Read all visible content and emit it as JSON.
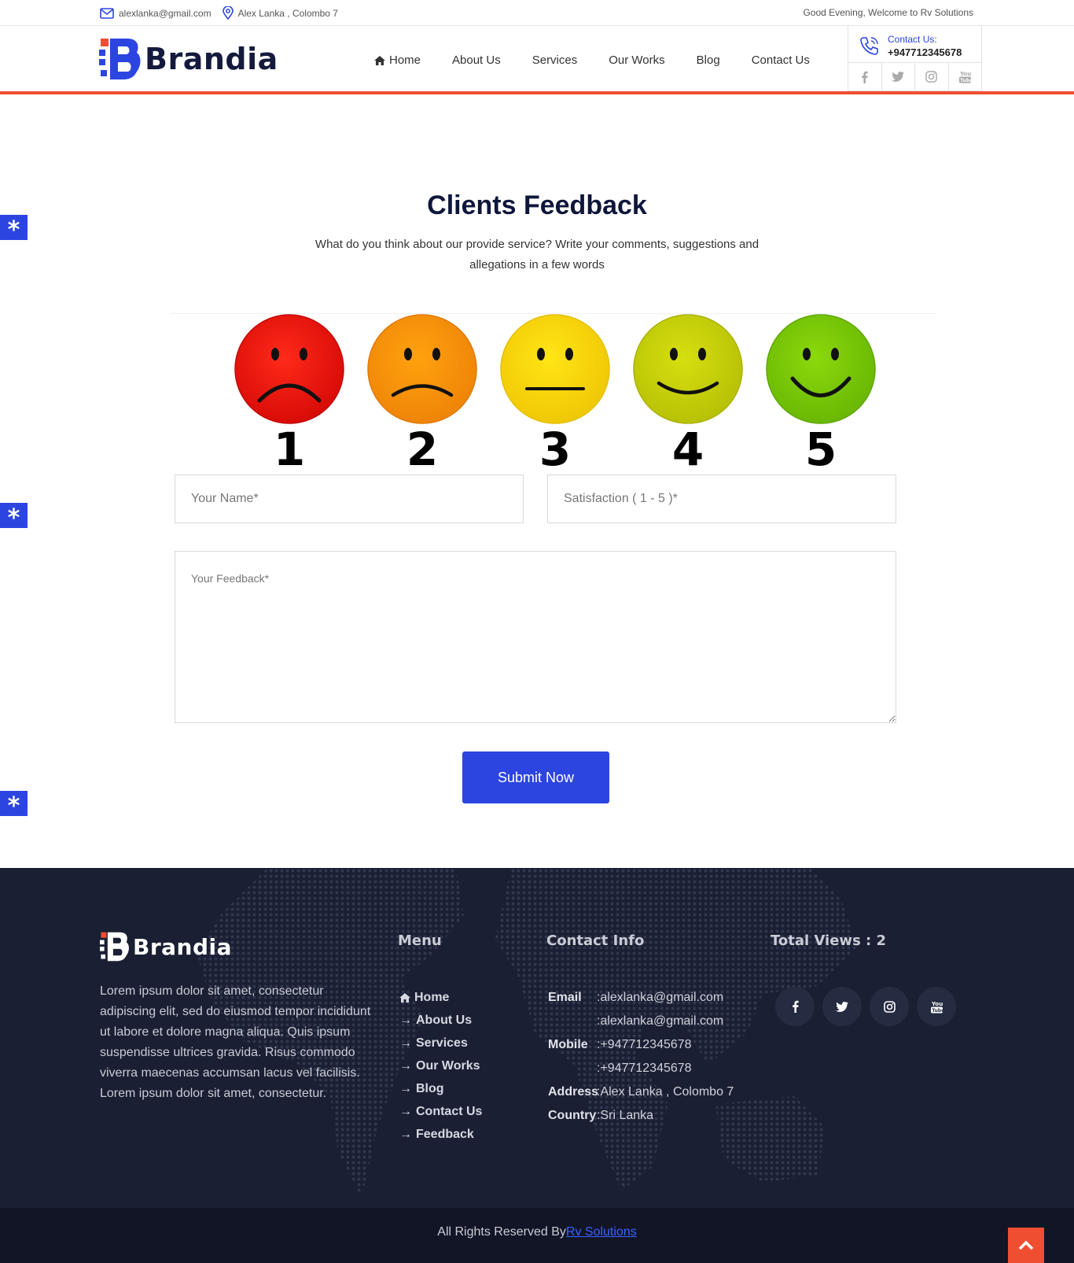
{
  "topbar": {
    "email": "alexlanka@gmail.com",
    "location": "Alex Lanka , Colombo 7",
    "greeting": "Good Evening, Welcome to Rv Solutions"
  },
  "brand": {
    "name": "Brandia"
  },
  "nav": {
    "home": "Home",
    "about": "About Us",
    "services": "Services",
    "works": "Our Works",
    "blog": "Blog",
    "contact": "Contact Us"
  },
  "header_contact": {
    "label": "Contact Us:",
    "phone": "+947712345678"
  },
  "feedback": {
    "title": "Clients Feedback",
    "subtitle": "What do you think about our provide service? Write your comments, suggestions and allegations in a few words",
    "ratings": [
      "1",
      "2",
      "3",
      "4",
      "5"
    ],
    "name_placeholder": "Your Name*",
    "satisfaction_placeholder": "Satisfaction ( 1 - 5 )*",
    "feedback_placeholder": "Your Feedback*",
    "submit_label": "Submit Now"
  },
  "footer": {
    "about": "Lorem ipsum dolor sit amet, consectetur adipiscing elit, sed do eiusmod tempor incididunt ut labore et dolore magna aliqua. Quis ipsum suspendisse ultrices gravida. Risus commodo viverra maecenas accumsan lacus vel facilisis. Lorem ipsum dolor sit amet, consectetur.",
    "menu_title": "Menu",
    "menu": [
      "Home",
      "About Us",
      "Services",
      "Our Works",
      "Blog",
      "Contact Us",
      "Feedback"
    ],
    "contact_title": "Contact Info",
    "contact": {
      "email_label": "Email",
      "email1": ":alexlanka@gmail.com",
      "email2": ":alexlanka@gmail.com",
      "mobile_label": "Mobile",
      "mobile1": ":+947712345678",
      "mobile2": ":+947712345678",
      "address_label": "Address",
      "address": ":Alex Lanka , Colombo 7",
      "country_label": "Country",
      "country": ":Sri Lanka"
    },
    "views": "Total Views : 2",
    "copyright": "All Rights Reserved By",
    "copyright_link": "Rv Solutions"
  },
  "icons": [
    "envelope-icon",
    "map-pin-icon",
    "home-icon",
    "phone-icon",
    "facebook-icon",
    "twitter-icon",
    "instagram-icon",
    "youtube-icon",
    "arrow-right-icon",
    "arrow-up-icon",
    "asterisk-icon"
  ],
  "colors": {
    "accent": "#2c45e0",
    "brand_red": "#f04e31",
    "dark": "#141a3d",
    "footer_bg": "#1a1f33"
  }
}
